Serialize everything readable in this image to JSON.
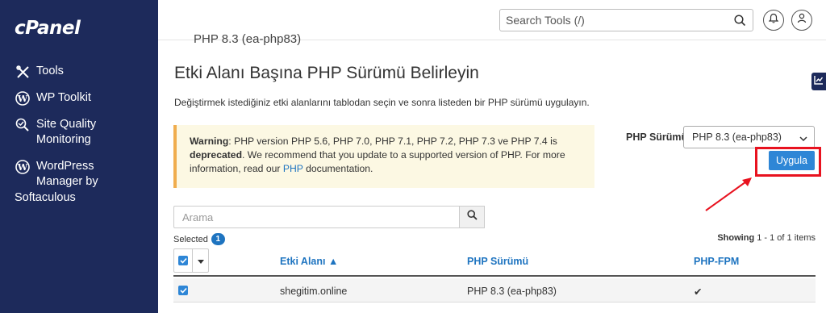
{
  "sidebar": {
    "logo": "cPanel",
    "items": [
      {
        "label_lines": [
          "Tools"
        ],
        "icon": "tools-icon"
      },
      {
        "label_lines": [
          "WP Toolkit"
        ],
        "icon": "wordpress-icon"
      },
      {
        "label_lines": [
          "Site Quality",
          "Monitoring"
        ],
        "icon": "site-quality-icon"
      },
      {
        "label_lines": [
          "WordPress",
          "Manager by",
          "Softaculous"
        ],
        "icon": "wordpress-icon"
      }
    ]
  },
  "header": {
    "search_placeholder": "Search Tools (/)",
    "notifications_icon": "bell-icon",
    "user_icon": "user-icon"
  },
  "main": {
    "cut_text": "PHP 8.3 (ea-php83)",
    "title": "Etki Alanı Başına PHP Sürümü Belirleyin",
    "description": "Değiştirmek istediğiniz etki alanlarını tablodan seçin ve sonra listeden bir PHP sürümü uygulayın.",
    "warning": {
      "strong": "Warning",
      "text1": ": PHP version PHP 5.6, PHP 7.0, PHP 7.1, PHP 7.2, PHP 7.3 ve PHP 7.4 is",
      "strong2": "deprecated",
      "text2": ". We recommend that you update to a supported version of PHP. For more",
      "text3": "information, read our ",
      "link": "PHP",
      "text4": " documentation."
    },
    "php_label": "PHP Sürümü",
    "php_select_value": "PHP 8.3 (ea-php83)",
    "apply_button": "Uygula",
    "filter_placeholder": "Arama",
    "selected_label": "Selected",
    "selected_count": "1",
    "showing_prefix": "Showing ",
    "showing_range": "1 - 1 of 1 items",
    "columns": {
      "domain": "Etki Alanı ▲",
      "php_version": "PHP Sürümü",
      "php_fpm": "PHP-FPM"
    },
    "rows": [
      {
        "domain": "shegitim.online",
        "php_version": "PHP 8.3 (ea-php83)",
        "fpm": "✔"
      }
    ]
  },
  "colors": {
    "sidebar_bg": "#1d2a5b",
    "accent": "#2e86d6",
    "highlight": "#e8121f",
    "warning_bg": "#fcf8e3"
  }
}
